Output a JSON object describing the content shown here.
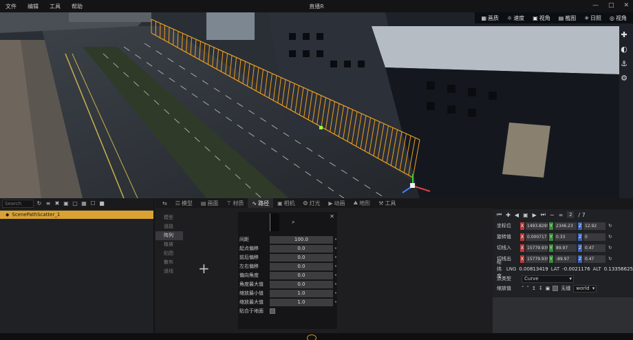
{
  "menu": [
    "文件",
    "编辑",
    "工具",
    "帮助"
  ],
  "window": {
    "title": "直播R",
    "minimize": "—",
    "maximize": "□",
    "close": "✕"
  },
  "view_toolbar": [
    {
      "icon": "▦",
      "label": "画质"
    },
    {
      "icon": "☼",
      "label": "速度"
    },
    {
      "icon": "▣",
      "label": "视角"
    },
    {
      "icon": "▤",
      "label": "截图"
    },
    {
      "icon": "✳",
      "label": "日照"
    },
    {
      "icon": "◎",
      "label": "视角"
    }
  ],
  "side_tools": [
    "✚",
    "◐",
    "⚓",
    "⚙"
  ],
  "outliner": {
    "search_placeholder": "Search",
    "item": "ScenePathScatter_1",
    "toolbar_icons": [
      "↻",
      "≡",
      "✖",
      "▣",
      "▢",
      "▦",
      "☐",
      "■"
    ]
  },
  "tabs": [
    {
      "icon": "⇆",
      "label": ""
    },
    {
      "icon": "☲",
      "label": "模型"
    },
    {
      "icon": "▤",
      "label": "画面"
    },
    {
      "icon": "⊤",
      "label": "材质"
    },
    {
      "icon": "∿",
      "label": "路径"
    },
    {
      "icon": "▣",
      "label": "相机"
    },
    {
      "icon": "❂",
      "label": "灯光"
    },
    {
      "icon": "▶",
      "label": "动画"
    },
    {
      "icon": "⛰",
      "label": "地形"
    },
    {
      "icon": "⚒",
      "label": "工具"
    }
  ],
  "categories": [
    "模型",
    "道路",
    "阵列",
    "植被",
    "贴图",
    "散布",
    "道线"
  ],
  "add_symbol": "+",
  "props": {
    "close": "✕",
    "search_icon": "⌕",
    "rows": [
      {
        "label": "间距",
        "value": "100.0"
      },
      {
        "label": "起点偏移",
        "value": "0.0"
      },
      {
        "label": "前后偏移",
        "value": "0.0"
      },
      {
        "label": "左右偏移",
        "value": "0.0"
      },
      {
        "label": "偏向角度",
        "value": "0.0"
      },
      {
        "label": "角度最大值",
        "value": "0.0"
      },
      {
        "label": "缩放最小值",
        "value": "1.0"
      },
      {
        "label": "缩放最大值",
        "value": "1.0"
      }
    ],
    "check_label": "贴合于地面"
  },
  "transform": {
    "frame": "2",
    "frame_total": "/ 7",
    "rows": [
      {
        "label": "坐标位",
        "x": "1493.8295",
        "y": "2346.23",
        "z": "12.92"
      },
      {
        "label": "旋转值",
        "x": "0.000717",
        "y": "0.33",
        "z": "0"
      },
      {
        "label": "切线入",
        "x": "15779.939",
        "y": "89.97",
        "z": "0.47"
      },
      {
        "label": "切线出",
        "x": "15779.939",
        "y": "-89.97",
        "z": "0.47"
      }
    ],
    "geo_label": "经纬度",
    "lng_label": "LNG",
    "lng": "0.00813419",
    "lat_label": "LAT",
    "lat": "-0.0021176",
    "alt_label": "ALT",
    "alt": "0.13356625",
    "point_label": "点类型",
    "point_value": "Curve",
    "scale_label": "缩放值",
    "world_label": "world",
    "lock_label": "无缝"
  },
  "colors": {
    "accent": "#d9a233",
    "fence": "#f0a020"
  }
}
